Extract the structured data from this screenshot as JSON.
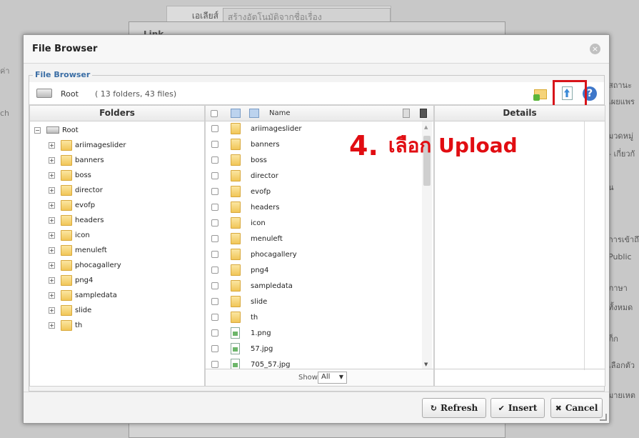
{
  "background": {
    "form_label": "เอเลียส์",
    "form_value": "สร้างอัตโนมัติจากชื่อเรื่อง",
    "link_dialog_title": "Link",
    "left_fragments": [
      "ค่า",
      "ch"
    ],
    "right_fragments": [
      "สถานะ",
      "เผยแพร",
      "มวดหมู่",
      "- เกี่ยวกั",
      "น",
      "การเข้าถึ",
      "Public",
      "ภาษา",
      "ทั้งหมด",
      "ภ็ก",
      "เลือกตัว",
      "มายเหต"
    ]
  },
  "dialog": {
    "title": "File Browser",
    "close_glyph": "×",
    "legend": "File Browser",
    "toolbar": {
      "path": "Root",
      "count": "( 13 folders, 43 files)",
      "help_glyph": "?"
    },
    "folders_pane": {
      "header": "Folders",
      "root": "Root",
      "items": [
        "ariimageslider",
        "banners",
        "boss",
        "director",
        "evofp",
        "headers",
        "icon",
        "menuleft",
        "phocagallery",
        "png4",
        "sampledata",
        "slide",
        "th"
      ]
    },
    "files_pane": {
      "header_name": "Name",
      "folders": [
        "ariimageslider",
        "banners",
        "boss",
        "director",
        "evofp",
        "headers",
        "icon",
        "menuleft",
        "phocagallery",
        "png4",
        "sampledata",
        "slide",
        "th"
      ],
      "files": [
        "1.png",
        "57.jpg",
        "705_57.jpg"
      ],
      "show_label": "Show",
      "show_value": "All"
    },
    "details_pane": {
      "header": "Details"
    },
    "annotation": {
      "number": "4.",
      "text": "เลือก Upload"
    },
    "buttons": {
      "refresh": "Refresh",
      "insert": "Insert",
      "cancel": "Cancel"
    }
  }
}
